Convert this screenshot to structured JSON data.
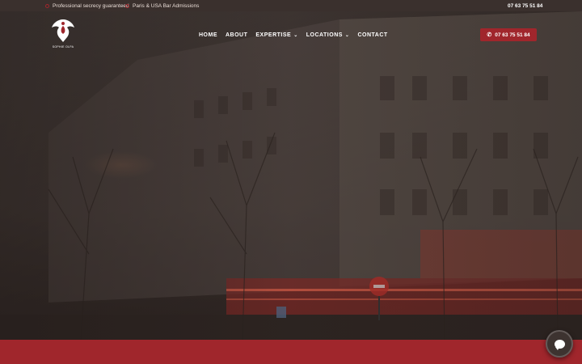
{
  "topbar": {
    "secrecy": "Professional secrecy guaranteed",
    "admissions": "Paris & USA Bar Admissions",
    "phone": "07 63 75 51 84"
  },
  "logo": {
    "text": "SOPHIE OLPA"
  },
  "nav": {
    "home": "HOME",
    "about": "ABOUT",
    "expertise": "EXPERTISE",
    "locations": "LOCATIONS",
    "contact": "CONTACT"
  },
  "cta": {
    "phone": "07 63 75 51 84",
    "icon": "phone-icon"
  },
  "chat": {
    "icon": "chat-icon"
  },
  "colors": {
    "brand": "#a0262c",
    "topbar": "#3a302d"
  }
}
